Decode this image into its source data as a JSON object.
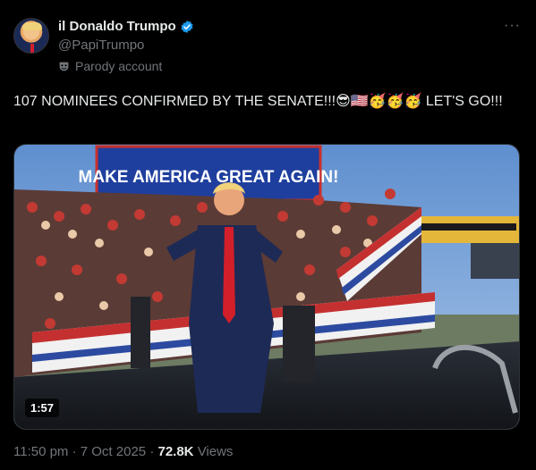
{
  "author": {
    "name": "il Donaldo Trumpo",
    "handle": "@PapiTrumpo",
    "label": "Parody account",
    "verified": true
  },
  "post": {
    "text": "107 NOMINEES CONFIRMED BY THE SENATE!!!😎🇺🇸🥳🥳🥳 LET'S GO!!!",
    "timestamp": "11:50 pm · 7 Oct 2025",
    "separator": "·",
    "views_count": "72.8K",
    "views_label": "Views"
  },
  "media": {
    "duration": "1:57",
    "banner_text": "MAKE AMERICA GREAT AGAIN!"
  },
  "menu": {
    "more": "···"
  },
  "colors": {
    "background": "#000000",
    "verified_blue": "#1d9bf0",
    "muted": "#71767b"
  }
}
